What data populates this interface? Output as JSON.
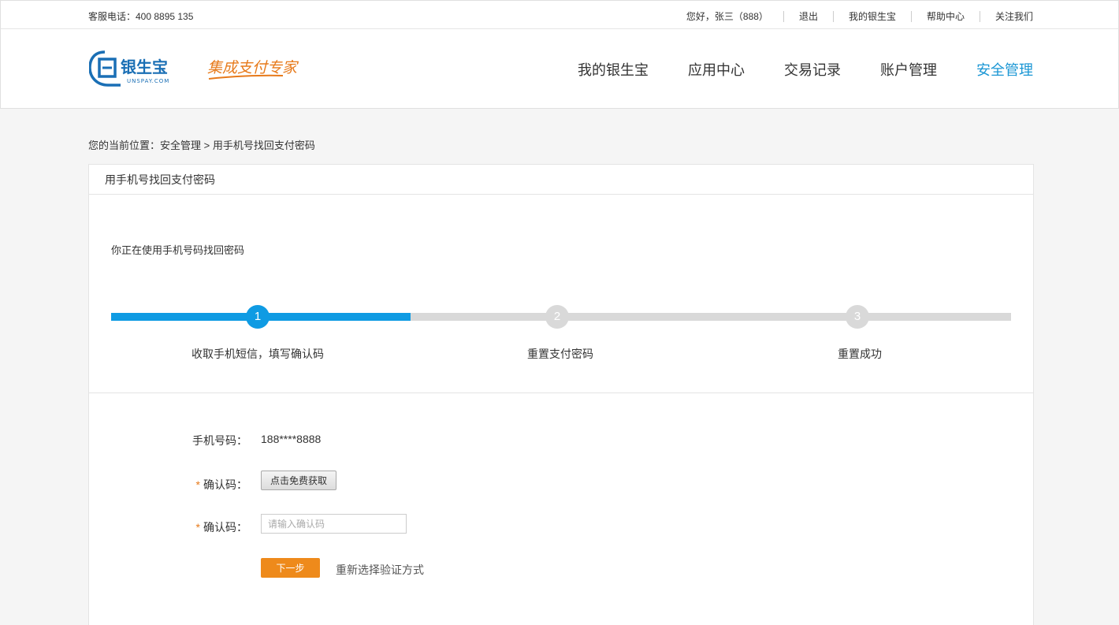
{
  "topbar": {
    "hotline": "客服电话：400 8895 135",
    "greeting": "您好，张三（888）",
    "logout": "退出",
    "my_account": "我的银生宝",
    "help": "帮助中心",
    "follow": "关注我们"
  },
  "header": {
    "logo_text": "银生宝",
    "logo_sub": "UNSPAY.COM",
    "slogan": "集成支付专家",
    "nav": [
      "我的银生宝",
      "应用中心",
      "交易记录",
      "账户管理",
      "安全管理"
    ],
    "active_nav": "安全管理",
    "brand_color": "#1a96d4"
  },
  "breadcrumb": "您的当前位置：安全管理 > 用手机号找回支付密码",
  "panel": {
    "title": "用手机号找回支付密码",
    "intro": "你正在使用手机号码找回密码",
    "steps": [
      {
        "number": "1",
        "label": "收取手机短信，填写确认码",
        "active": true
      },
      {
        "number": "2",
        "label": "重置支付密码",
        "active": false
      },
      {
        "number": "3",
        "label": "重置成功",
        "active": false
      }
    ],
    "progress_fraction": 0.333
  },
  "form": {
    "phone_label": "手机号码：",
    "phone_value": "188****8888",
    "required_mark": "*",
    "code_label_1": "确认码：",
    "get_code_button": "点击免费获取",
    "code_label_2": "确认码：",
    "code_placeholder": "请输入确认码",
    "next_button": "下一步",
    "reselect_link": "重新选择验证方式"
  },
  "colors": {
    "progress": "#0f9be3",
    "next_button": "#ee8a1b",
    "required": "#e77a1b"
  }
}
